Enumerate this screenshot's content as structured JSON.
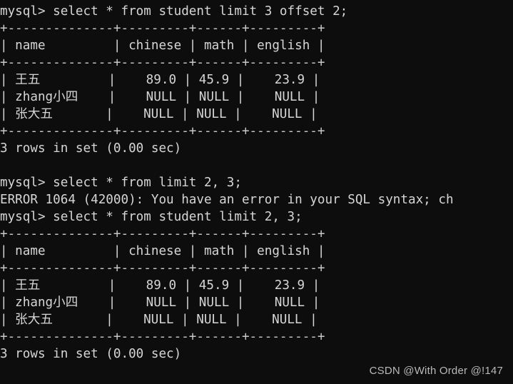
{
  "terminal": {
    "background_color": "#0d0d0d",
    "foreground_color": "#d6d6d6",
    "prompt": "mysql> "
  },
  "watermark": {
    "text": "CSDN @With Order @!147",
    "color": "#b9b9b9"
  },
  "table": {
    "separator": "+--------------+---------+------+---------+",
    "header_row": "| name         | chinese | math | english |",
    "columns": [
      "name",
      "chinese",
      "math",
      "english"
    ],
    "rows": [
      {
        "name": "王五",
        "chinese": "89.0",
        "math": "45.9",
        "english": "23.9"
      },
      {
        "name": "zhang小四",
        "chinese": "NULL",
        "math": "NULL",
        "english": "NULL"
      },
      {
        "name": "张大五",
        "chinese": "NULL",
        "math": "NULL",
        "english": "NULL"
      }
    ],
    "data_lines": [
      "| 王五         |    89.0 | 45.9 |    23.9 |",
      "| zhang小四    |    NULL | NULL |    NULL |",
      "| 张大五       |    NULL | NULL |    NULL |"
    ],
    "result_status": "3 rows in set (0.00 sec)"
  },
  "lines": [
    {
      "id": "command-1",
      "kind": "command",
      "text": "mysql> select * from student limit 3 offset 2;"
    },
    {
      "id": "rule-1",
      "kind": "rule",
      "text": "+--------------+---------+------+---------+"
    },
    {
      "id": "header-1",
      "kind": "header",
      "text": "| name         | chinese | math | english |"
    },
    {
      "id": "rule-2",
      "kind": "rule",
      "text": "+--------------+---------+------+---------+"
    },
    {
      "id": "row-1",
      "kind": "row",
      "text": "| 王五         |    89.0 | 45.9 |    23.9 |"
    },
    {
      "id": "row-2",
      "kind": "row",
      "text": "| zhang小四    |    NULL | NULL |    NULL |"
    },
    {
      "id": "row-3",
      "kind": "row",
      "text": "| 张大五       |    NULL | NULL |    NULL |"
    },
    {
      "id": "rule-3",
      "kind": "rule",
      "text": "+--------------+---------+------+---------+"
    },
    {
      "id": "status-1",
      "kind": "status",
      "text": "3 rows in set (0.00 sec)"
    },
    {
      "id": "blank-1",
      "kind": "blank",
      "text": " "
    },
    {
      "id": "command-2",
      "kind": "command",
      "text": "mysql> select * from limit 2, 3;"
    },
    {
      "id": "error-1",
      "kind": "error",
      "text": "ERROR 1064 (42000): You have an error in your SQL syntax; ch"
    },
    {
      "id": "command-3",
      "kind": "command",
      "text": "mysql> select * from student limit 2, 3;"
    },
    {
      "id": "rule-4",
      "kind": "rule",
      "text": "+--------------+---------+------+---------+"
    },
    {
      "id": "header-2",
      "kind": "header",
      "text": "| name         | chinese | math | english |"
    },
    {
      "id": "rule-5",
      "kind": "rule",
      "text": "+--------------+---------+------+---------+"
    },
    {
      "id": "row-4",
      "kind": "row",
      "text": "| 王五         |    89.0 | 45.9 |    23.9 |"
    },
    {
      "id": "row-5",
      "kind": "row",
      "text": "| zhang小四    |    NULL | NULL |    NULL |"
    },
    {
      "id": "row-6",
      "kind": "row",
      "text": "| 张大五       |    NULL | NULL |    NULL |"
    },
    {
      "id": "rule-6",
      "kind": "rule",
      "text": "+--------------+---------+------+---------+"
    },
    {
      "id": "status-2",
      "kind": "status",
      "text": "3 rows in set (0.00 sec)"
    }
  ]
}
